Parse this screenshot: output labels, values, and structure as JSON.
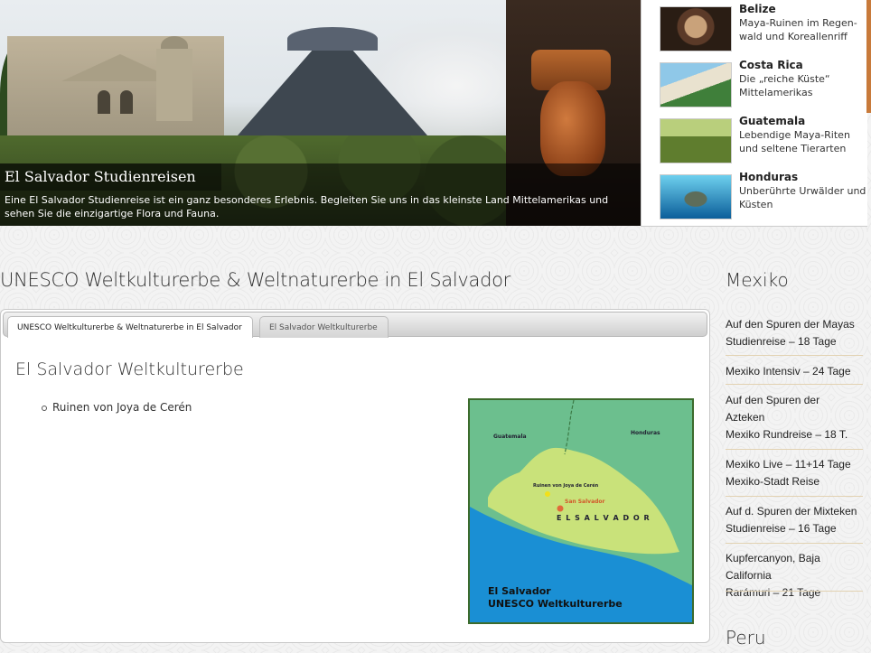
{
  "hero": {
    "title": "El Salvador Studienreisen",
    "text": "Eine El Salvador Studienreise ist ein ganz besonderes Erlebnis. Begleiten Sie uns in das kleinste Land Mittelamerikas und sehen Sie die einzigartige Flora und Fauna."
  },
  "countries": [
    {
      "name": "Belize",
      "desc": "Maya-Ruinen im Regen-wald und Koreallenriff"
    },
    {
      "name": "Costa Rica",
      "desc": "Die „reiche Küste“ Mittelamerikas"
    },
    {
      "name": "Guatemala",
      "desc": "Lebendige Maya-Riten und seltene Tierarten"
    },
    {
      "name": "Honduras",
      "desc": "Unberührte Urwälder und Küsten"
    }
  ],
  "main": {
    "title": "UNESCO Weltkulturerbe & Weltnaturerbe in El Salvador",
    "tabs": [
      {
        "label": "UNESCO Weltkulturerbe & Weltnaturerbe in El Salvador",
        "active": true
      },
      {
        "label": "El Salvador Weltkulturerbe",
        "active": false
      }
    ],
    "section_title": "El Salvador Weltkulturerbe",
    "items": [
      "Ruinen von Joya de Cerén"
    ]
  },
  "map": {
    "labels": {
      "guatemala": "Guatemala",
      "honduras": "Honduras",
      "ruinen": "Ruinen von Joya de Cerén",
      "san_salvador": "San Salvador",
      "country": "E L   S A L V A D O R"
    },
    "title_line1": "El Salvador",
    "title_line2": "UNESCO  Weltkulturerbe",
    "colors": {
      "land": "#c9e27a",
      "sea": "#1a8fd4",
      "neighbor": "#6cbf8e",
      "capital": "#e06a3a",
      "site": "#f2e018"
    }
  },
  "sidebar": {
    "sections": [
      {
        "heading": "Mexiko",
        "links": [
          [
            "Auf den Spuren der Mayas",
            "Studienreise – 18 Tage"
          ],
          [
            "Mexiko Intensiv – 24 Tage"
          ],
          [
            "Auf den Spuren der",
            "Azteken",
            "Mexiko Rundreise – 18 T."
          ],
          [
            "Mexiko Live – 11+14 Tage",
            "Mexiko-Stadt Reise"
          ],
          [
            "Auf d. Spuren der Mixteken",
            "Studienreise – 16 Tage"
          ],
          [
            "Kupfercanyon, Baja California",
            "Rarámuri – 21 Tage"
          ]
        ]
      },
      {
        "heading": "Peru",
        "links": []
      }
    ]
  }
}
